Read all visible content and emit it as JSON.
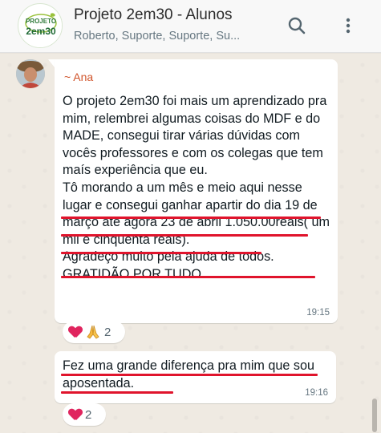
{
  "header": {
    "title": "Projeto 2em30 - Alunos",
    "subtitle": "Roberto, Suporte, Suporte, Su...",
    "logo_text_top": "PROJETO",
    "logo_text_bottom": "2em30",
    "search_icon": "search-icon",
    "menu_icon": "kebab-menu-icon"
  },
  "messages": [
    {
      "sender": "~ Ana",
      "text": "O projeto 2em30 foi mais um aprendizado pra mim, relembrei algumas coisas do MDF e do MADE, consegui tirar várias dúvidas com vocês professores e com os colegas que tem maís experiência que eu.\nTô morando a um mês e meio aqui nesse lugar e consegui ganhar apartir do dia 19 de março até agora 23 de abril 1.050.00reais( um mil e cinquenta reais).\nAgradeço muito pela ajuda de todos.\nGRATIDÃO POR TUDO.",
      "time": "19:15",
      "reactions": {
        "emojis": [
          "red-heart",
          "folded-hands"
        ],
        "count": "2"
      }
    },
    {
      "text": "Fez uma grande diferença pra mim que sou aposentada.",
      "time": "19:16",
      "reactions": {
        "emojis": [
          "red-heart"
        ],
        "count": "2"
      }
    }
  ],
  "colors": {
    "sender_name": "#d0542b",
    "underline": "#e0142c",
    "heart": "#e0245e",
    "bubble": "#ffffff",
    "chat_bg": "#efeae2"
  }
}
